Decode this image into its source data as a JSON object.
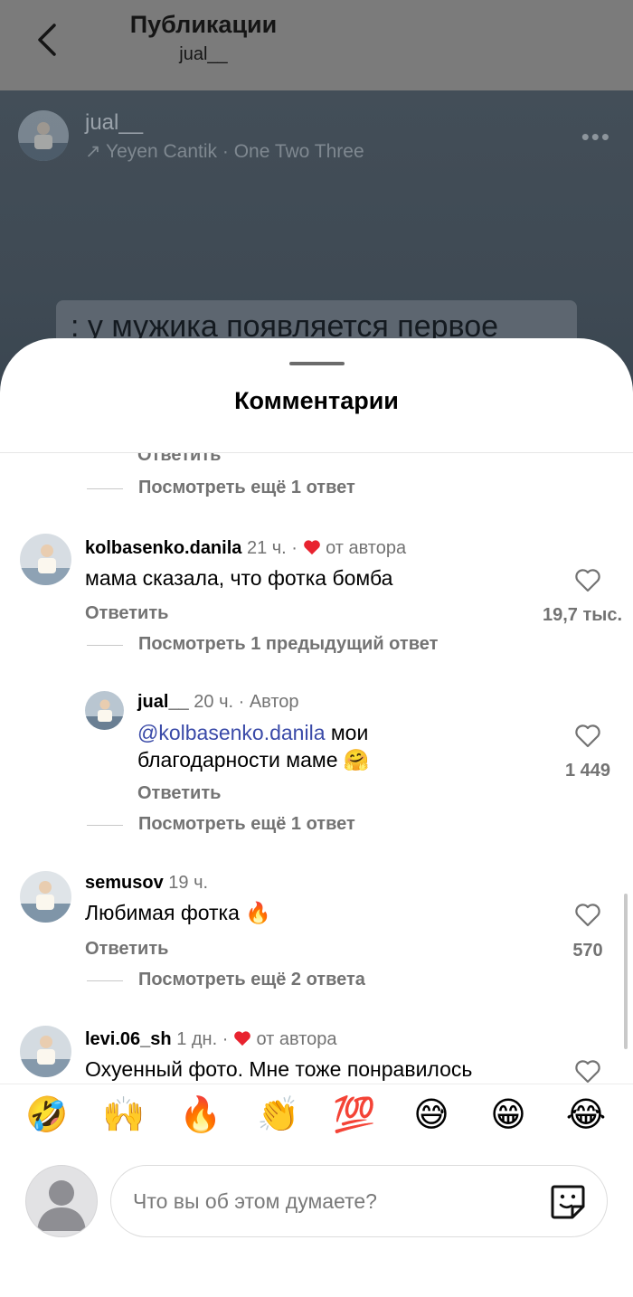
{
  "header": {
    "title": "Публикации",
    "subtitle": "jual__"
  },
  "post": {
    "username": "jual__",
    "music": "↗ Yeyen Cantik · One Two Three",
    "caption_fragment": ": у мужика появляется первое",
    "menu": "•••"
  },
  "sheet": {
    "title": "Комментарии"
  },
  "comments": {
    "top": {
      "reply_label": "Ответить",
      "view_more": "Посмотреть ещё 1 ответ"
    },
    "c1": {
      "username": "kolbasenko.danila",
      "time": "21 ч.",
      "dot": "·",
      "author_label": "от автора",
      "text": "мама сказала, что фотка бомба",
      "reply_label": "Ответить",
      "likes": "19,7 тыс.",
      "view_more": "Посмотреть 1 предыдущий ответ"
    },
    "c1_reply": {
      "username": "jual__",
      "time": "20 ч.",
      "dot": "·",
      "author_tag": "Автор",
      "mention": "@kolbasenko.danila",
      "text_after_mention": " мои",
      "text_line2": "благодарности маме 🤗",
      "reply_label": "Ответить",
      "likes": "1 449",
      "view_more": "Посмотреть ещё 1 ответ"
    },
    "c2": {
      "username": "semusov",
      "time": "19 ч.",
      "text": "Любимая фотка 🔥",
      "reply_label": "Ответить",
      "likes": "570",
      "view_more": "Посмотреть ещё 2 ответа"
    },
    "c3": {
      "username": "levi.06_sh",
      "time": "1 дн.",
      "dot": "·",
      "author_label": "от автора",
      "text": "Охуенный фото. Мне тоже понравилось"
    }
  },
  "emoji_bar": [
    "🤣",
    "🙌",
    "🔥",
    "👏",
    "💯",
    "😅",
    "😁",
    "😂"
  ],
  "composer": {
    "placeholder": "Что вы об этом думаете?"
  },
  "colors": {
    "heart_red": "#e8232f",
    "mention_blue": "#3a4aa8"
  }
}
